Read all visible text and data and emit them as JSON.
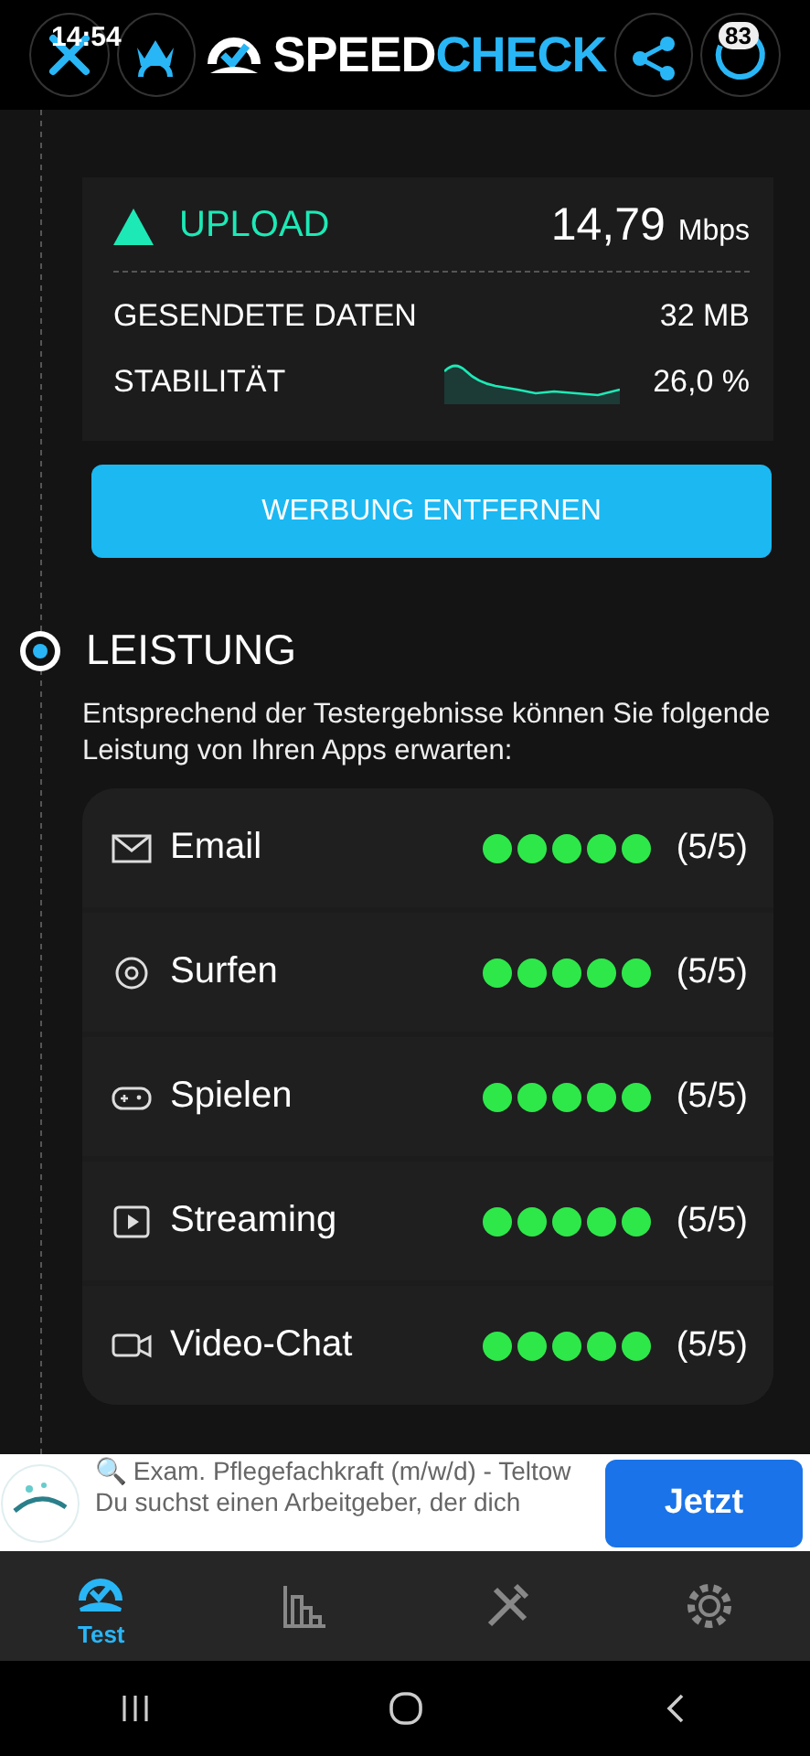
{
  "status_bar": {
    "time": "14:54",
    "battery": "83"
  },
  "header": {
    "logo_left": "SPEED",
    "logo_right": "CHECK"
  },
  "upload": {
    "label": "UPLOAD",
    "value": "14,79",
    "unit": "Mbps",
    "rows": [
      {
        "label": "GESENDETE DATEN",
        "value": "32 MB",
        "kind": "text"
      },
      {
        "label": "STABILITÄT",
        "value": "26,0 %",
        "kind": "sparkline"
      }
    ]
  },
  "remove_ads_button": "WERBUNG ENTFERNEN",
  "performance": {
    "title": "LEISTUNG",
    "description": "Entsprechend der Testergebnisse können Sie folgende Leistung von Ihren Apps erwarten:",
    "apps": [
      {
        "name": "Email",
        "kind": "mail",
        "stars": 5,
        "score": "(5/5)"
      },
      {
        "name": "Surfen",
        "kind": "browser",
        "stars": 5,
        "score": "(5/5)"
      },
      {
        "name": "Spielen",
        "kind": "game",
        "stars": 5,
        "score": "(5/5)"
      },
      {
        "name": "Streaming",
        "kind": "play",
        "stars": 5,
        "score": "(5/5)"
      },
      {
        "name": "Video-Chat",
        "kind": "video",
        "stars": 5,
        "score": "(5/5)"
      }
    ]
  },
  "ad": {
    "text": "🔍 Exam. Pflegefachkraft (m/w/d) - Teltow Du suchst einen Arbeitgeber, der dich",
    "button": "Jetzt"
  },
  "bottom_nav": [
    {
      "kind": "test",
      "label": "Test",
      "selected": true
    },
    {
      "kind": "stats",
      "selected": false
    },
    {
      "kind": "tools",
      "selected": false
    },
    {
      "kind": "settings",
      "selected": false
    }
  ]
}
